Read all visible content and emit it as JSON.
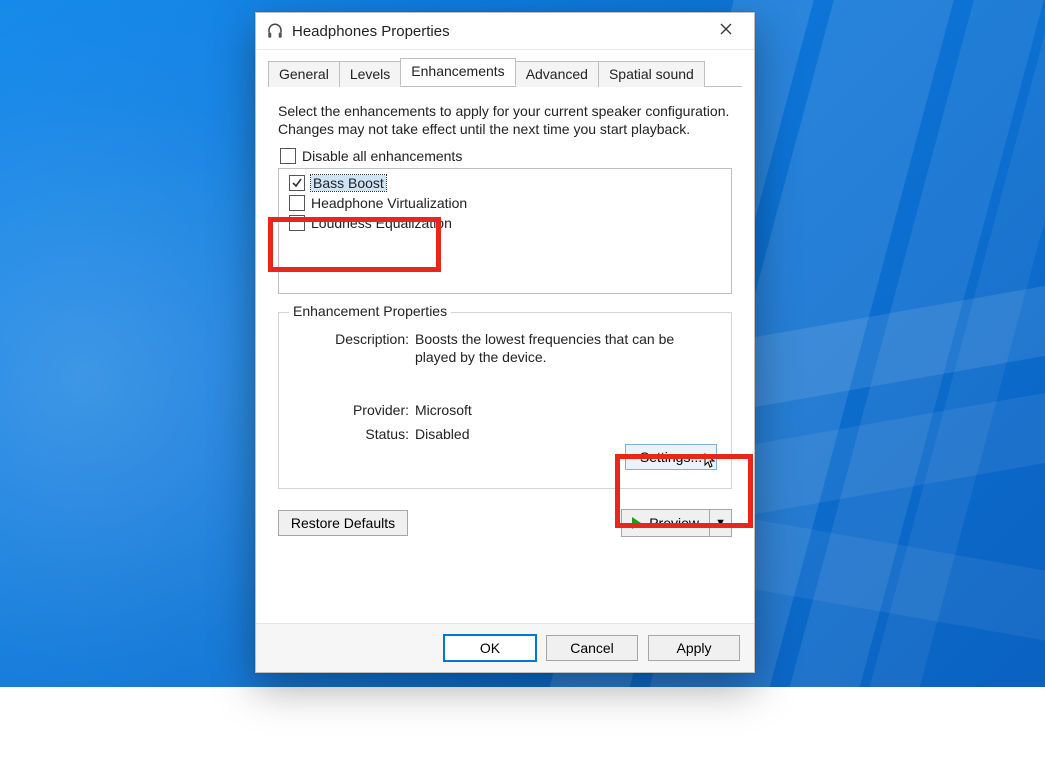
{
  "wallpaper": {
    "name": "windows-10-light-beams"
  },
  "dialog": {
    "title": "Headphones Properties",
    "tabs": [
      {
        "label": "General",
        "active": false
      },
      {
        "label": "Levels",
        "active": false
      },
      {
        "label": "Enhancements",
        "active": true
      },
      {
        "label": "Advanced",
        "active": false
      },
      {
        "label": "Spatial sound",
        "active": false
      }
    ],
    "intro": "Select the enhancements to apply for your current speaker configuration. Changes may not take effect until the next time you start playback.",
    "disable_all": {
      "label": "Disable all enhancements",
      "checked": false
    },
    "enhancements": [
      {
        "label": "Bass Boost",
        "checked": true,
        "selected": true
      },
      {
        "label": "Headphone Virtualization",
        "checked": false,
        "selected": false
      },
      {
        "label": "Loudness Equalization",
        "checked": false,
        "selected": false
      }
    ],
    "properties": {
      "legend": "Enhancement Properties",
      "description_label": "Description:",
      "description": "Boosts the lowest frequencies that can be played by the device.",
      "provider_label": "Provider:",
      "provider": "Microsoft",
      "status_label": "Status:",
      "status": "Disabled",
      "settings_label": "Settings..."
    },
    "restore_label": "Restore Defaults",
    "preview_label": "Preview",
    "ok_label": "OK",
    "cancel_label": "Cancel",
    "apply_label": "Apply"
  },
  "annotations": [
    {
      "name": "highlight-bass-boost"
    },
    {
      "name": "highlight-settings"
    }
  ]
}
